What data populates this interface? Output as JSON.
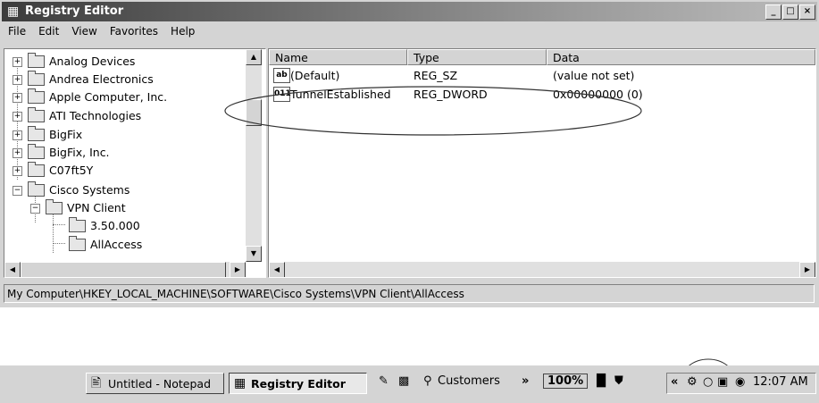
{
  "window": {
    "title": "Registry Editor"
  },
  "menu": [
    "File",
    "Edit",
    "View",
    "Favorites",
    "Help"
  ],
  "tree": [
    {
      "label": "Analog Devices",
      "expander": "+"
    },
    {
      "label": "Andrea Electronics",
      "expander": "+"
    },
    {
      "label": "Apple Computer, Inc.",
      "expander": "+"
    },
    {
      "label": "ATI Technologies",
      "expander": "+"
    },
    {
      "label": "BigFix",
      "expander": "+"
    },
    {
      "label": "BigFix, Inc.",
      "expander": "+"
    },
    {
      "label": "C07ft5Y",
      "expander": "+"
    },
    {
      "label": "Cisco Systems",
      "expander": "−"
    },
    {
      "label": "VPN Client",
      "expander": "−"
    },
    {
      "label": "3.50.000",
      "expander": ""
    },
    {
      "label": "AllAccess",
      "expander": ""
    }
  ],
  "columns": {
    "name": "Name",
    "type": "Type",
    "data": "Data"
  },
  "values": [
    {
      "icon": "ab",
      "name": "(Default)",
      "type": "REG_SZ",
      "data": "(value not set)"
    },
    {
      "icon": "011",
      "name": "TunnelEstablished",
      "type": "REG_DWORD",
      "data": "0x00000000 (0)"
    }
  ],
  "status": "My Computer\\HKEY_LOCAL_MACHINE\\SOFTWARE\\Cisco Systems\\VPN Client\\AllAccess",
  "taskbar": {
    "tasks": [
      {
        "label": "Untitled - Notepad"
      },
      {
        "label": "Registry Editor"
      }
    ],
    "quick_customers": "Customers",
    "chevron": "»",
    "zoom": "100%",
    "tray_chevron": "«",
    "clock": "12:07 AM"
  }
}
